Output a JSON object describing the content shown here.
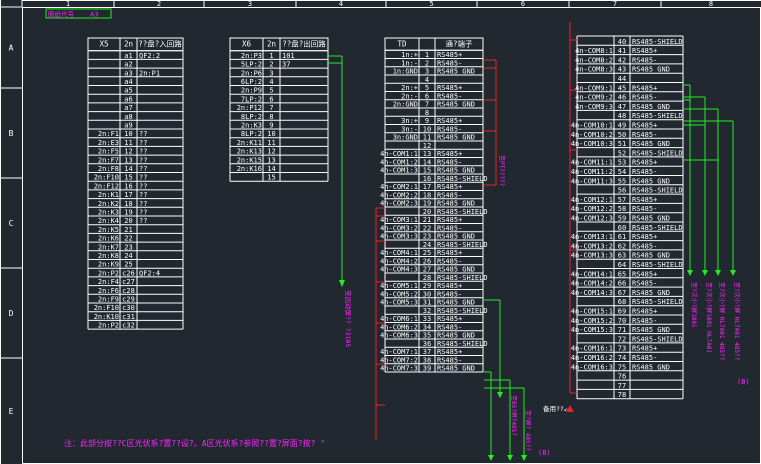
{
  "title_block": {
    "label": "图纸代号",
    "sheet": "A3"
  },
  "columns": [
    "1",
    "2",
    "3",
    "4",
    "5",
    "6",
    "7",
    "8"
  ],
  "rows": [
    "A",
    "B",
    "C",
    "D",
    "E"
  ],
  "x5": {
    "title": "X5",
    "col2": "2n",
    "col3": "??盘?入回路",
    "rows": [
      [
        "",
        "a1",
        "QF2:2"
      ],
      [
        "",
        "a2",
        ""
      ],
      [
        "",
        "a3",
        "2n:P1"
      ],
      [
        "",
        "a4",
        ""
      ],
      [
        "",
        "a5",
        ""
      ],
      [
        "",
        "a6",
        ""
      ],
      [
        "",
        "a7",
        ""
      ],
      [
        "",
        "a8",
        ""
      ],
      [
        "",
        "a9",
        ""
      ],
      [
        "2n:F1",
        "10",
        "??"
      ],
      [
        "2n:E3",
        "11",
        "??"
      ],
      [
        "2n:F5",
        "12",
        "??"
      ],
      [
        "2n:F7",
        "13",
        "??"
      ],
      [
        "2n:F8",
        "14",
        "??"
      ],
      [
        "2n:F10",
        "15",
        "??"
      ],
      [
        "2n:F12",
        "16",
        "??"
      ],
      [
        "2n:K1",
        "17",
        "??"
      ],
      [
        "2n:K2",
        "18",
        "??"
      ],
      [
        "2n:K3",
        "19",
        "??"
      ],
      [
        "2n:K4",
        "20",
        "??"
      ],
      [
        "2n:K5",
        "21",
        ""
      ],
      [
        "2n:K6",
        "22",
        ""
      ],
      [
        "2n:K7",
        "23",
        ""
      ],
      [
        "2n:K8",
        "24",
        ""
      ],
      [
        "2n:K9",
        "25",
        ""
      ],
      [
        "2n:P2",
        "c26",
        "QF2:4"
      ],
      [
        "2n:F4",
        "c27",
        ""
      ],
      [
        "2n:F6",
        "c28",
        ""
      ],
      [
        "2n:F9",
        "c29",
        ""
      ],
      [
        "2n:F10",
        "c30",
        ""
      ],
      [
        "2n:K10",
        "c31",
        ""
      ],
      [
        "2n:P2",
        "c32",
        ""
      ]
    ]
  },
  "x6": {
    "title": "X6",
    "col2": "2n",
    "col3": "??盘?出回路",
    "rows": [
      [
        "2n:P3",
        "1",
        "101"
      ],
      [
        "5LP:2",
        "2",
        "37"
      ],
      [
        "2n:P6",
        "3",
        ""
      ],
      [
        "6LP:2",
        "4",
        ""
      ],
      [
        "2n:P9",
        "5",
        ""
      ],
      [
        "7LP:2",
        "6",
        ""
      ],
      [
        "2n:P12",
        "7",
        ""
      ],
      [
        "8LP:2",
        "8",
        ""
      ],
      [
        "2n:K3",
        "9",
        ""
      ],
      [
        "8LP:2",
        "10",
        ""
      ],
      [
        "2n:K11",
        "11",
        ""
      ],
      [
        "2n:K13",
        "12",
        ""
      ],
      [
        "2n:K15",
        "13",
        ""
      ],
      [
        "2n:K16",
        "14",
        ""
      ],
      [
        "",
        "15",
        ""
      ]
    ]
  },
  "td": {
    "title": "TD",
    "col3": "通?端子",
    "rows": [
      [
        "1n:+",
        "1",
        "RS485+"
      ],
      [
        "1n:-",
        "2",
        "RS485-"
      ],
      [
        "1n:GND",
        "3",
        "RS485 GND"
      ],
      [
        "",
        "4",
        ""
      ],
      [
        "2n:+",
        "5",
        "RS485+"
      ],
      [
        "2n:-",
        "6",
        "RS485-"
      ],
      [
        "2n:GND",
        "7",
        "RS485 GND"
      ],
      [
        "",
        "8",
        ""
      ],
      [
        "3n:+",
        "9",
        "RS485+"
      ],
      [
        "3n:-",
        "10",
        "RS485-"
      ],
      [
        "3n:GND",
        "11",
        "RS485 GND"
      ],
      [
        "",
        "12",
        ""
      ],
      [
        "4n-COM1:1",
        "13",
        "RS485+"
      ],
      [
        "4n-COM1:2",
        "14",
        "RS485-"
      ],
      [
        "4n-COM1:3",
        "15",
        "RS485 GND"
      ],
      [
        "",
        "16",
        "RS485-SHIELD"
      ],
      [
        "4n-COM2:1",
        "17",
        "RS485+"
      ],
      [
        "4n-COM2:2",
        "18",
        "RS485-"
      ],
      [
        "4n-COM2:3",
        "19",
        "RS485 GND"
      ],
      [
        "",
        "20",
        "RS485-SHIELD"
      ],
      [
        "4n-COM3:1",
        "21",
        "RS485+"
      ],
      [
        "4n-COM3:2",
        "22",
        "RS485-"
      ],
      [
        "4n-COM3:3",
        "23",
        "RS485 GND"
      ],
      [
        "",
        "24",
        "RS485-SHIELD"
      ],
      [
        "4n-COM4:1",
        "25",
        "RS485+"
      ],
      [
        "4n-COM4:2",
        "26",
        "RS485-"
      ],
      [
        "4n-COM4:3",
        "27",
        "RS485 GND"
      ],
      [
        "",
        "28",
        "RS485-SHIELD"
      ],
      [
        "4n-COM5:1",
        "29",
        "RS485+"
      ],
      [
        "4n-COM5:2",
        "30",
        "RS485-"
      ],
      [
        "4n-COM5:3",
        "31",
        "RS485 GND"
      ],
      [
        "",
        "32",
        "RS485-SHIELD"
      ],
      [
        "4n-COM6:1",
        "33",
        "RS485+"
      ],
      [
        "4n-COM6:2",
        "34",
        "RS485-"
      ],
      [
        "4n-COM6:3",
        "35",
        "RS485 GND"
      ],
      [
        "",
        "36",
        "RS485-SHIELD"
      ],
      [
        "4n-COM7:1",
        "37",
        "RS485+"
      ],
      [
        "4n-COM7:2",
        "38",
        "RS485-"
      ],
      [
        "4n-COM7:3",
        "39",
        "RS485 GND"
      ]
    ]
  },
  "td2": {
    "rows": [
      [
        "",
        "40",
        "RS485-SHIELD"
      ],
      [
        "4n-COM8:1",
        "41",
        "RS485+"
      ],
      [
        "4n-COM8:2",
        "42",
        "RS485-"
      ],
      [
        "4n-COM8:3",
        "43",
        "RS485 GND"
      ],
      [
        "",
        "44",
        ""
      ],
      [
        "4n-COM9:1",
        "45",
        "RS485+"
      ],
      [
        "4n-COM9:2",
        "46",
        "RS485-"
      ],
      [
        "4n-COM9:3",
        "47",
        "RS485 GND"
      ],
      [
        "",
        "48",
        "RS485-SHIELD"
      ],
      [
        "4n-COM10:1",
        "49",
        "RS485+"
      ],
      [
        "4n-COM10:2",
        "50",
        "RS485-"
      ],
      [
        "4n-COM10:3",
        "51",
        "RS485 GND"
      ],
      [
        "",
        "52",
        "RS485-SHIELD"
      ],
      [
        "4n-COM11:1",
        "53",
        "RS485+"
      ],
      [
        "4n-COM11:2",
        "54",
        "RS485-"
      ],
      [
        "4n-COM11:3",
        "55",
        "RS485 GND"
      ],
      [
        "",
        "56",
        "RS485-SHIELD"
      ],
      [
        "4n-COM12:1",
        "57",
        "RS485+"
      ],
      [
        "4n-COM12:2",
        "58",
        "RS485-"
      ],
      [
        "4n-COM12:3",
        "59",
        "RS485 GND"
      ],
      [
        "",
        "60",
        "RS485-SHIELD"
      ],
      [
        "4n-COM13:1",
        "61",
        "RS485+"
      ],
      [
        "4n-COM13:2",
        "62",
        "RS485-"
      ],
      [
        "4n-COM13:3",
        "63",
        "RS485 GND"
      ],
      [
        "",
        "64",
        "RS485-SHIELD"
      ],
      [
        "4n-COM14:1",
        "65",
        "RS485+"
      ],
      [
        "4n-COM14:2",
        "66",
        "RS485-"
      ],
      [
        "4n-COM14:3",
        "67",
        "RS485 GND"
      ],
      [
        "",
        "68",
        "RS485-SHIELD"
      ],
      [
        "4n-COM15:1",
        "69",
        "RS485+"
      ],
      [
        "4n-COM15:2",
        "70",
        "RS485-"
      ],
      [
        "4n-COM15:3",
        "71",
        "RS485 GND"
      ],
      [
        "",
        "72",
        "RS485-SHIELD"
      ],
      [
        "4n-COM16:1",
        "73",
        "RS485+"
      ],
      [
        "4n-COM16:2",
        "74",
        "RS485-"
      ],
      [
        "4n-COM16:3",
        "75",
        "RS485 GND"
      ],
      [
        "",
        "76",
        ""
      ],
      [
        "",
        "77",
        ""
      ],
      [
        "",
        "78",
        ""
      ]
    ]
  },
  "annotations": {
    "vert_left": "至远动屏??  ?3105",
    "vert_mid": "至PT?????",
    "vert_td_bottom": "至B5?屏?485?",
    "vert_td_bottom2": "至?屏? 485??",
    "suffix_a": "(B)",
    "vert_r1": "至?次小?屏1001",
    "vert_r2": "至?次小?屏1001  HL7A01",
    "vert_r3": "至?次小?屏  HL7A01 485??",
    "vert_r4": "至?次小?屏  HL7A01 485??",
    "suffix_b": "(B)",
    "spare_label": "备用??↙",
    "note": "注：此部分按??C区光伏系?置??设?。A区光伏系?参照??置?屏面?按? °"
  },
  "colors": {
    "bg": "#212830",
    "line": "#ffffff",
    "green": "#22ee22",
    "red": "#ee2222",
    "magenta": "#ff22ff",
    "yellow": "#ffff00"
  }
}
